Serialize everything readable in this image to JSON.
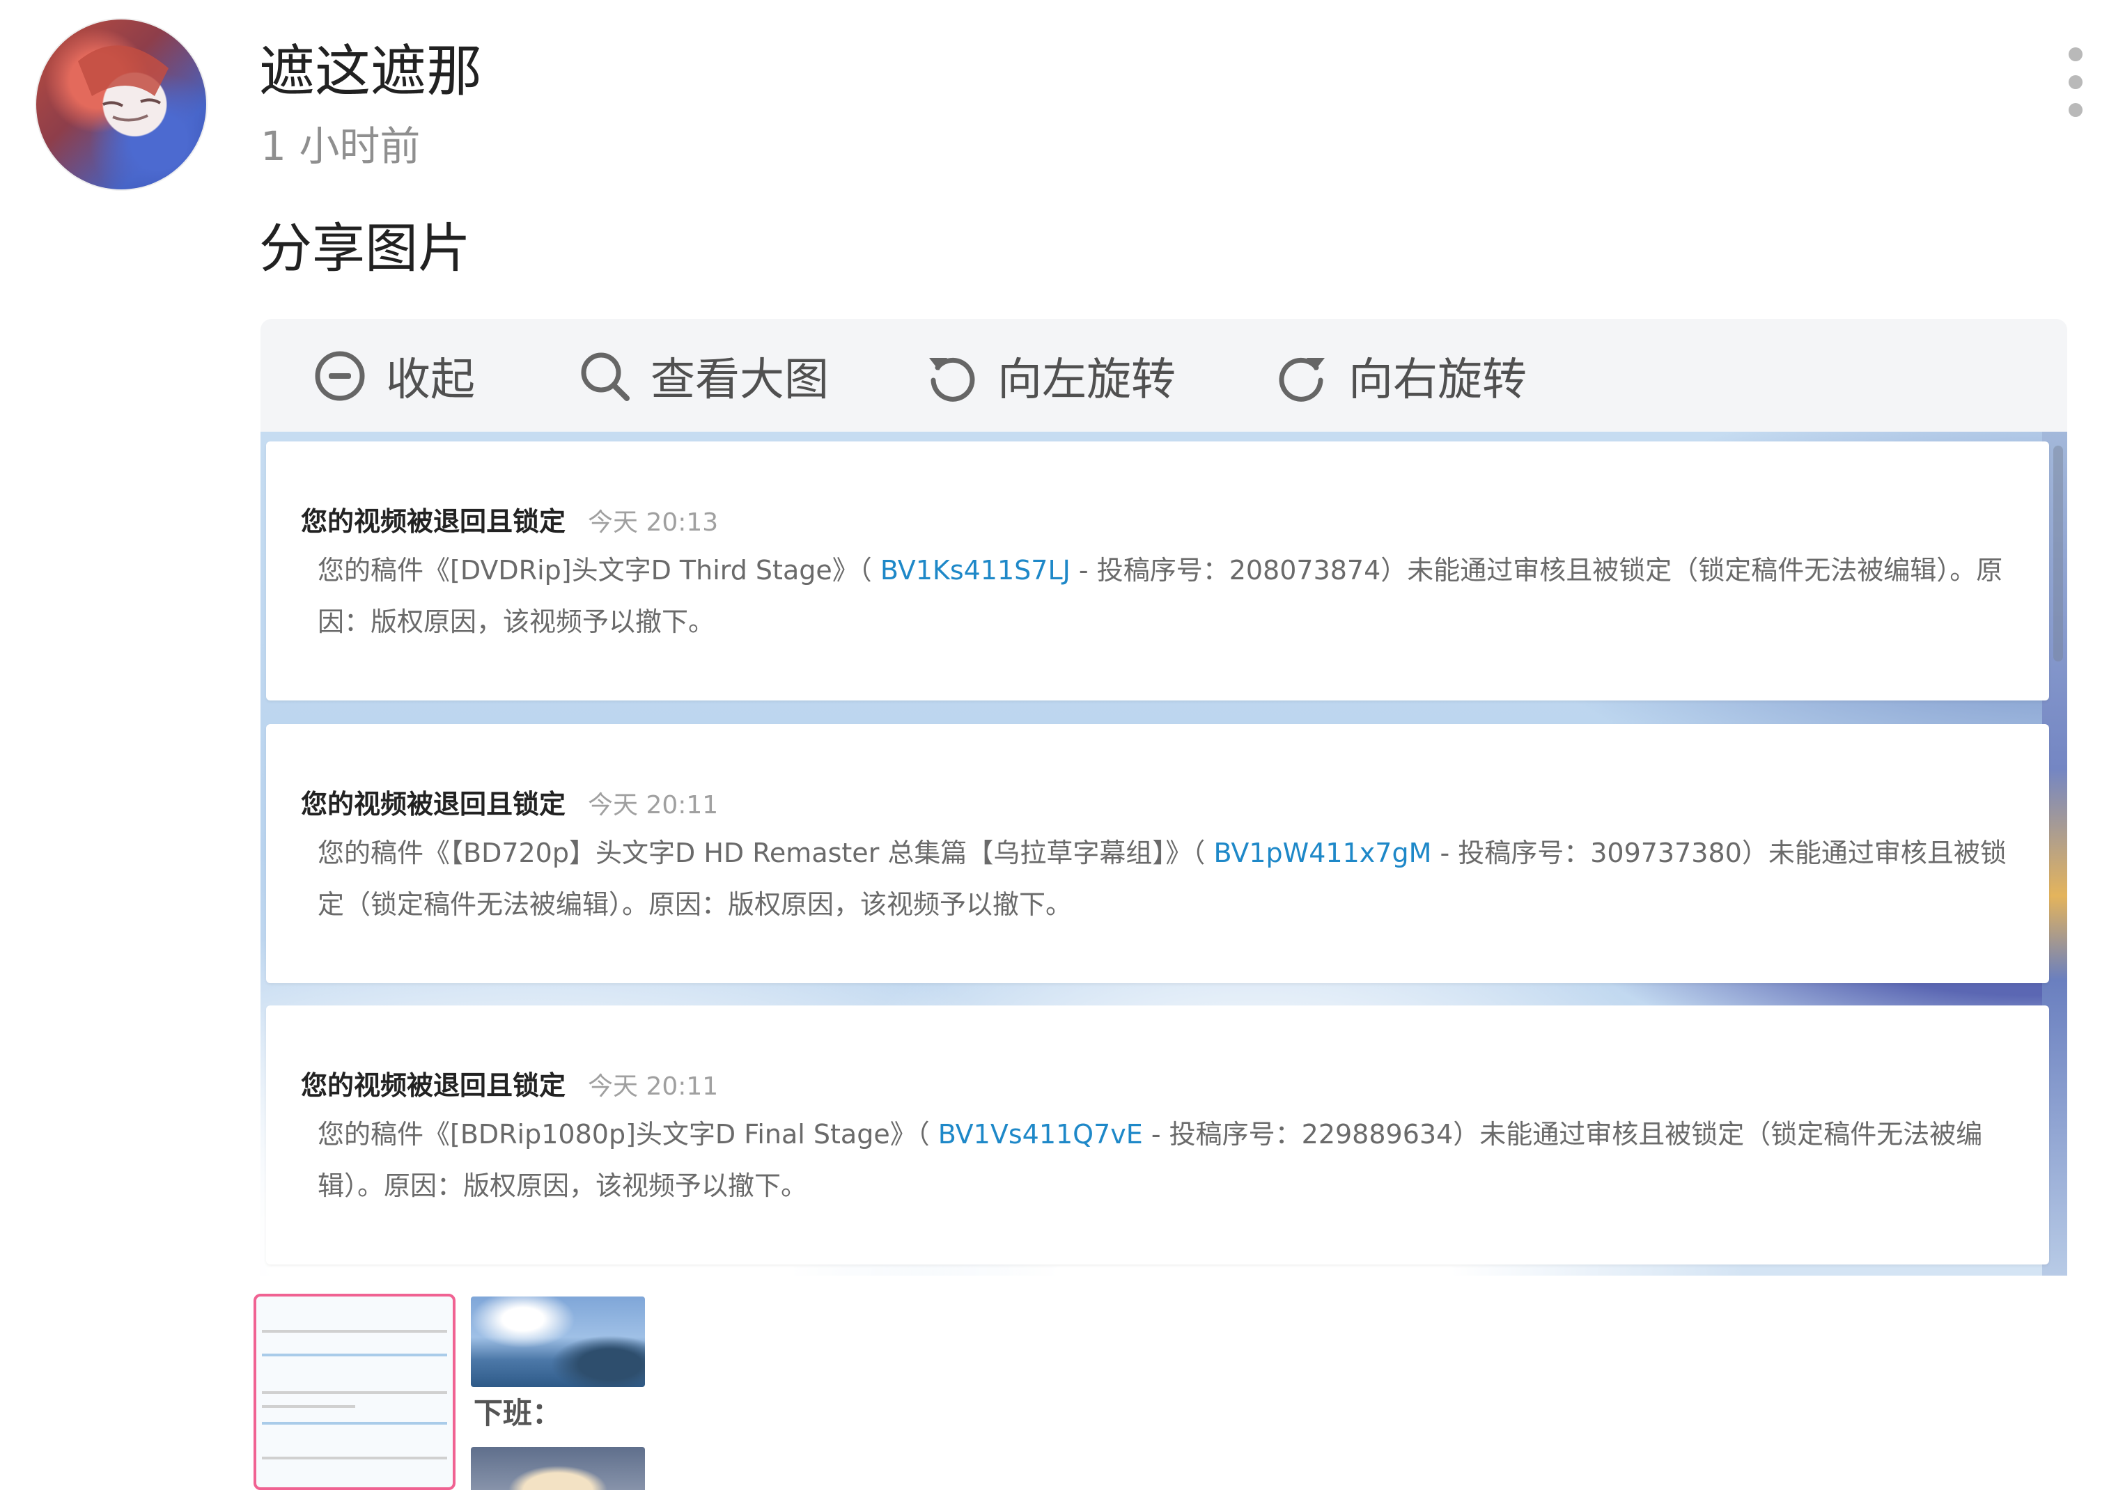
{
  "post": {
    "author": "遮这遮那",
    "time": "1 小时前",
    "text": "分享图片"
  },
  "toolbar": {
    "collapse_label": "收起",
    "view_large_label": "查看大图",
    "rotate_left_label": "向左旋转",
    "rotate_right_label": "向右旋转"
  },
  "messages": [
    {
      "title": "您的视频被退回且锁定",
      "time": "今天 20:13",
      "body_before": "您的稿件《[DVDRip]头文字D Third Stage》（ ",
      "bv": "BV1Ks411S7LJ",
      "body_after": " - 投稿序号：208073874）未能通过审核且被锁定（锁定稿件无法被编辑）。原因：版权原因，该视频予以撤下。"
    },
    {
      "title": "您的视频被退回且锁定",
      "time": "今天 20:11",
      "body_before": "您的稿件《【BD720p】头文字D HD Remaster 总集篇【乌拉草字幕组】》（ ",
      "bv": "BV1pW411x7gM",
      "body_after": " - 投稿序号：309737380）未能通过审核且被锁定（锁定稿件无法被编辑）。原因：版权原因，该视频予以撤下。"
    },
    {
      "title": "您的视频被退回且锁定",
      "time": "今天 20:11",
      "body_before": "您的稿件《[BDRip1080p]头文字D Final Stage》（ ",
      "bv": "BV1Vs411Q7vE",
      "body_after": " - 投稿序号：229889634）未能通过审核且被锁定（锁定稿件无法被编辑）。原因：版权原因，该视频予以撤下。"
    }
  ],
  "thumbnails": {
    "second_caption": "下班："
  },
  "colors": {
    "link": "#1e88c8",
    "selected_thumb_border": "#f06292",
    "toolbar_bg": "#f4f5f7"
  }
}
